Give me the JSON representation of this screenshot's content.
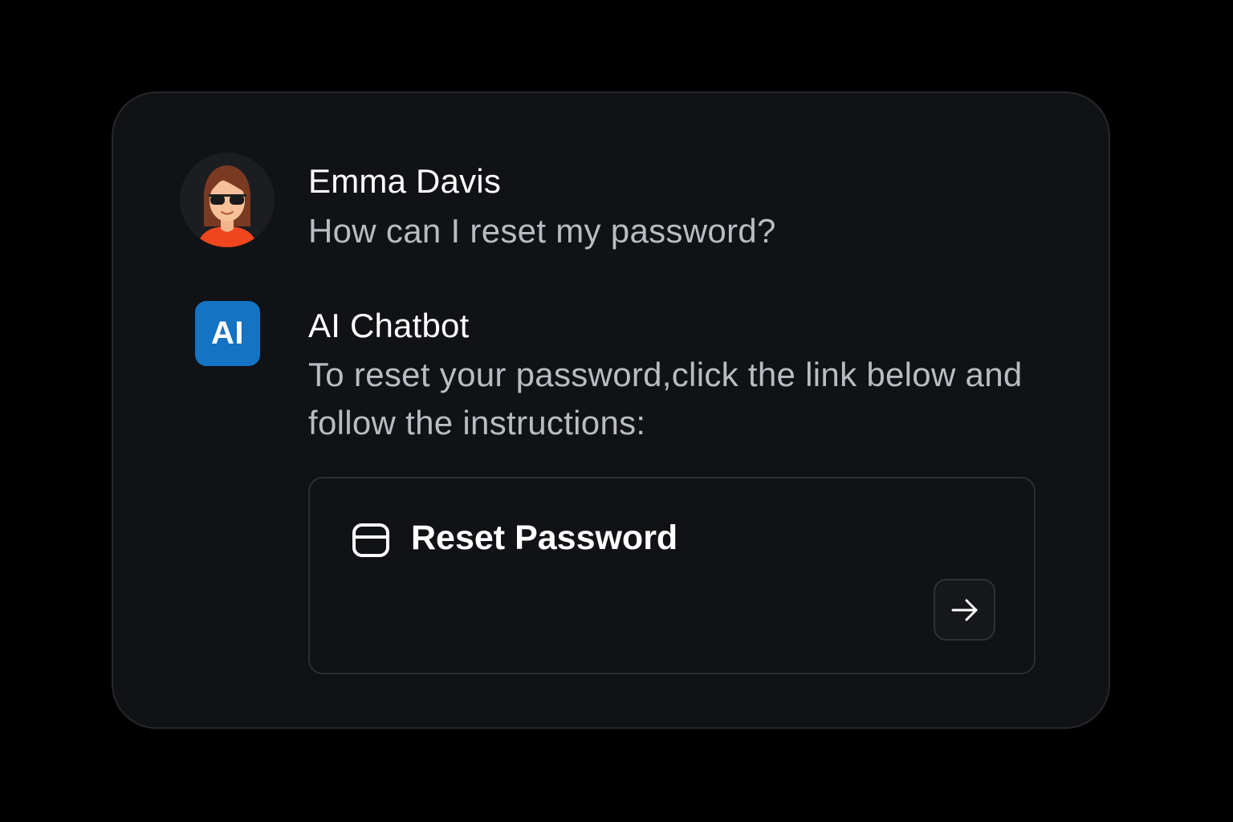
{
  "messages": [
    {
      "sender": "Emma Davis",
      "text": "How can I reset my password?",
      "avatar_icon": "user-avatar-woman-sunglasses"
    },
    {
      "sender": "AI Chatbot",
      "badge": "AI",
      "text": "To reset your password,click the link below and follow the instructions:",
      "badge_color": "#1473c2"
    }
  ],
  "link_card": {
    "icon": "card-icon",
    "label": "Reset Password",
    "action_icon": "arrow-right-icon"
  },
  "colors": {
    "background": "#000000",
    "card": "#111215",
    "name_text": "#ffffff",
    "message_text": "#b9bcc2",
    "accent": "#1473c2",
    "avatar_shirt": "#f0461e"
  }
}
